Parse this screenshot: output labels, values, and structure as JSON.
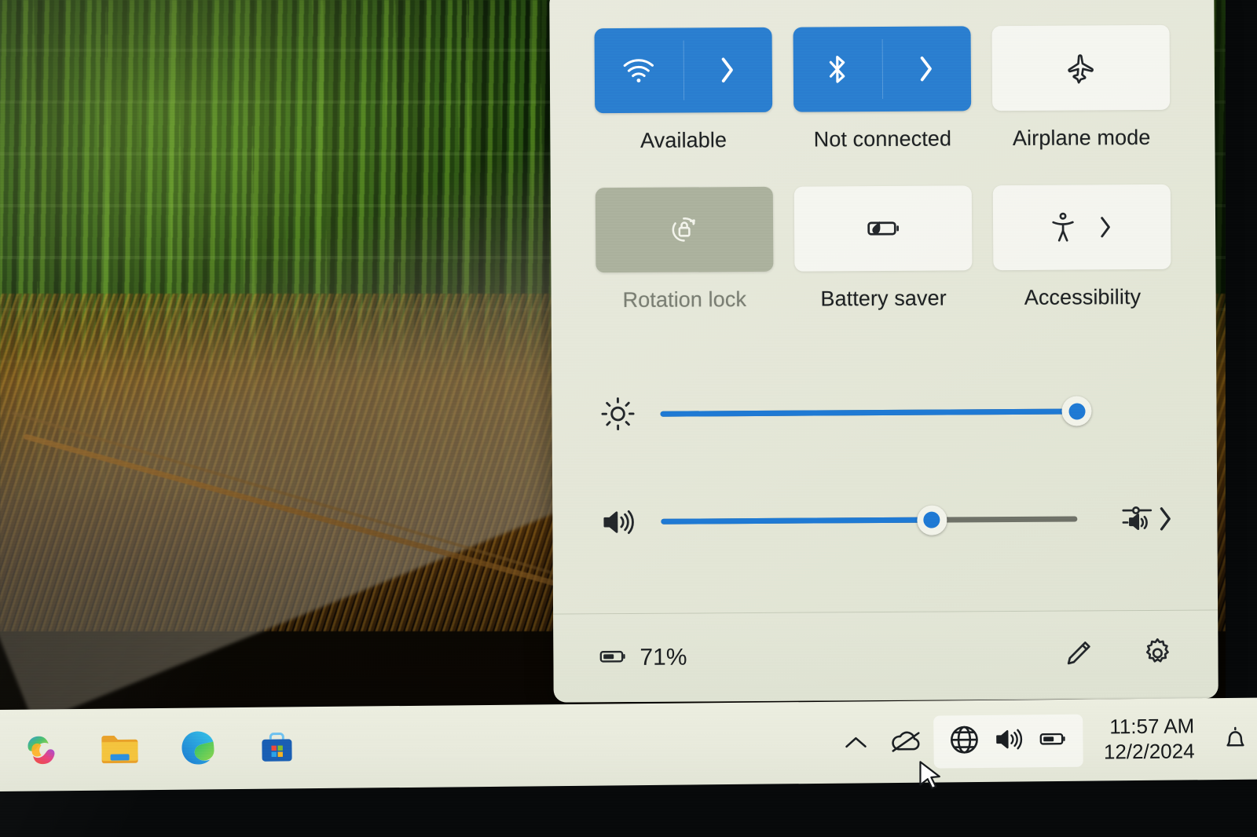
{
  "desktop": {
    "wallpaper_description": "bamboo forest path",
    "colors": {
      "bamboo_green": "#234a12",
      "grass_gold": "#96601 2",
      "path_grey": "#7a7260"
    }
  },
  "quick_settings": {
    "panel_name": "Quick Settings",
    "accent_color": "#2a7fd0",
    "tiles": [
      {
        "id": "wifi",
        "icon": "wifi-icon",
        "label": "Available",
        "state": "on",
        "has_chevron": true,
        "enabled": true
      },
      {
        "id": "bluetooth",
        "icon": "bluetooth-icon",
        "label": "Not connected",
        "state": "on",
        "has_chevron": true,
        "enabled": true
      },
      {
        "id": "airplane",
        "icon": "airplane-icon",
        "label": "Airplane mode",
        "state": "off",
        "has_chevron": false,
        "enabled": true
      },
      {
        "id": "rotation",
        "icon": "rotation-lock-icon",
        "label": "Rotation lock",
        "state": "disabled",
        "has_chevron": false,
        "enabled": false
      },
      {
        "id": "battery",
        "icon": "battery-saver-icon",
        "label": "Battery saver",
        "state": "off",
        "has_chevron": false,
        "enabled": true
      },
      {
        "id": "access",
        "icon": "accessibility-icon",
        "label": "Accessibility",
        "state": "off",
        "has_chevron": true,
        "enabled": true
      }
    ],
    "sliders": [
      {
        "id": "brightness",
        "icon": "brightness-icon",
        "value": 100,
        "min": 0,
        "max": 100,
        "has_trailing_control": false
      },
      {
        "id": "volume",
        "icon": "volume-icon",
        "value": 65,
        "min": 0,
        "max": 100,
        "has_trailing_control": true,
        "trailing_icon": "audio-output-selector-icon"
      }
    ],
    "footer": {
      "battery_icon": "battery-icon",
      "battery_percent": "71%",
      "edit_icon": "pencil-edit-icon",
      "settings_icon": "gear-settings-icon"
    }
  },
  "taskbar": {
    "apps": [
      {
        "id": "copilot",
        "name": "copilot-icon",
        "label": "Copilot"
      },
      {
        "id": "explorer",
        "name": "file-explorer-icon",
        "label": "File Explorer"
      },
      {
        "id": "edge",
        "name": "microsoft-edge-icon",
        "label": "Microsoft Edge"
      },
      {
        "id": "store",
        "name": "microsoft-store-icon",
        "label": "Microsoft Store"
      }
    ],
    "tray": {
      "hidden_icons": "chevron-up-icon",
      "onedrive": "onedrive-offline-icon",
      "network": "globe-network-icon",
      "volume": "speaker-volume-icon",
      "battery": "battery-icon"
    },
    "clock": {
      "time": "11:57 AM",
      "date": "12/2/2024"
    },
    "notifications": "notification-bell-icon"
  }
}
